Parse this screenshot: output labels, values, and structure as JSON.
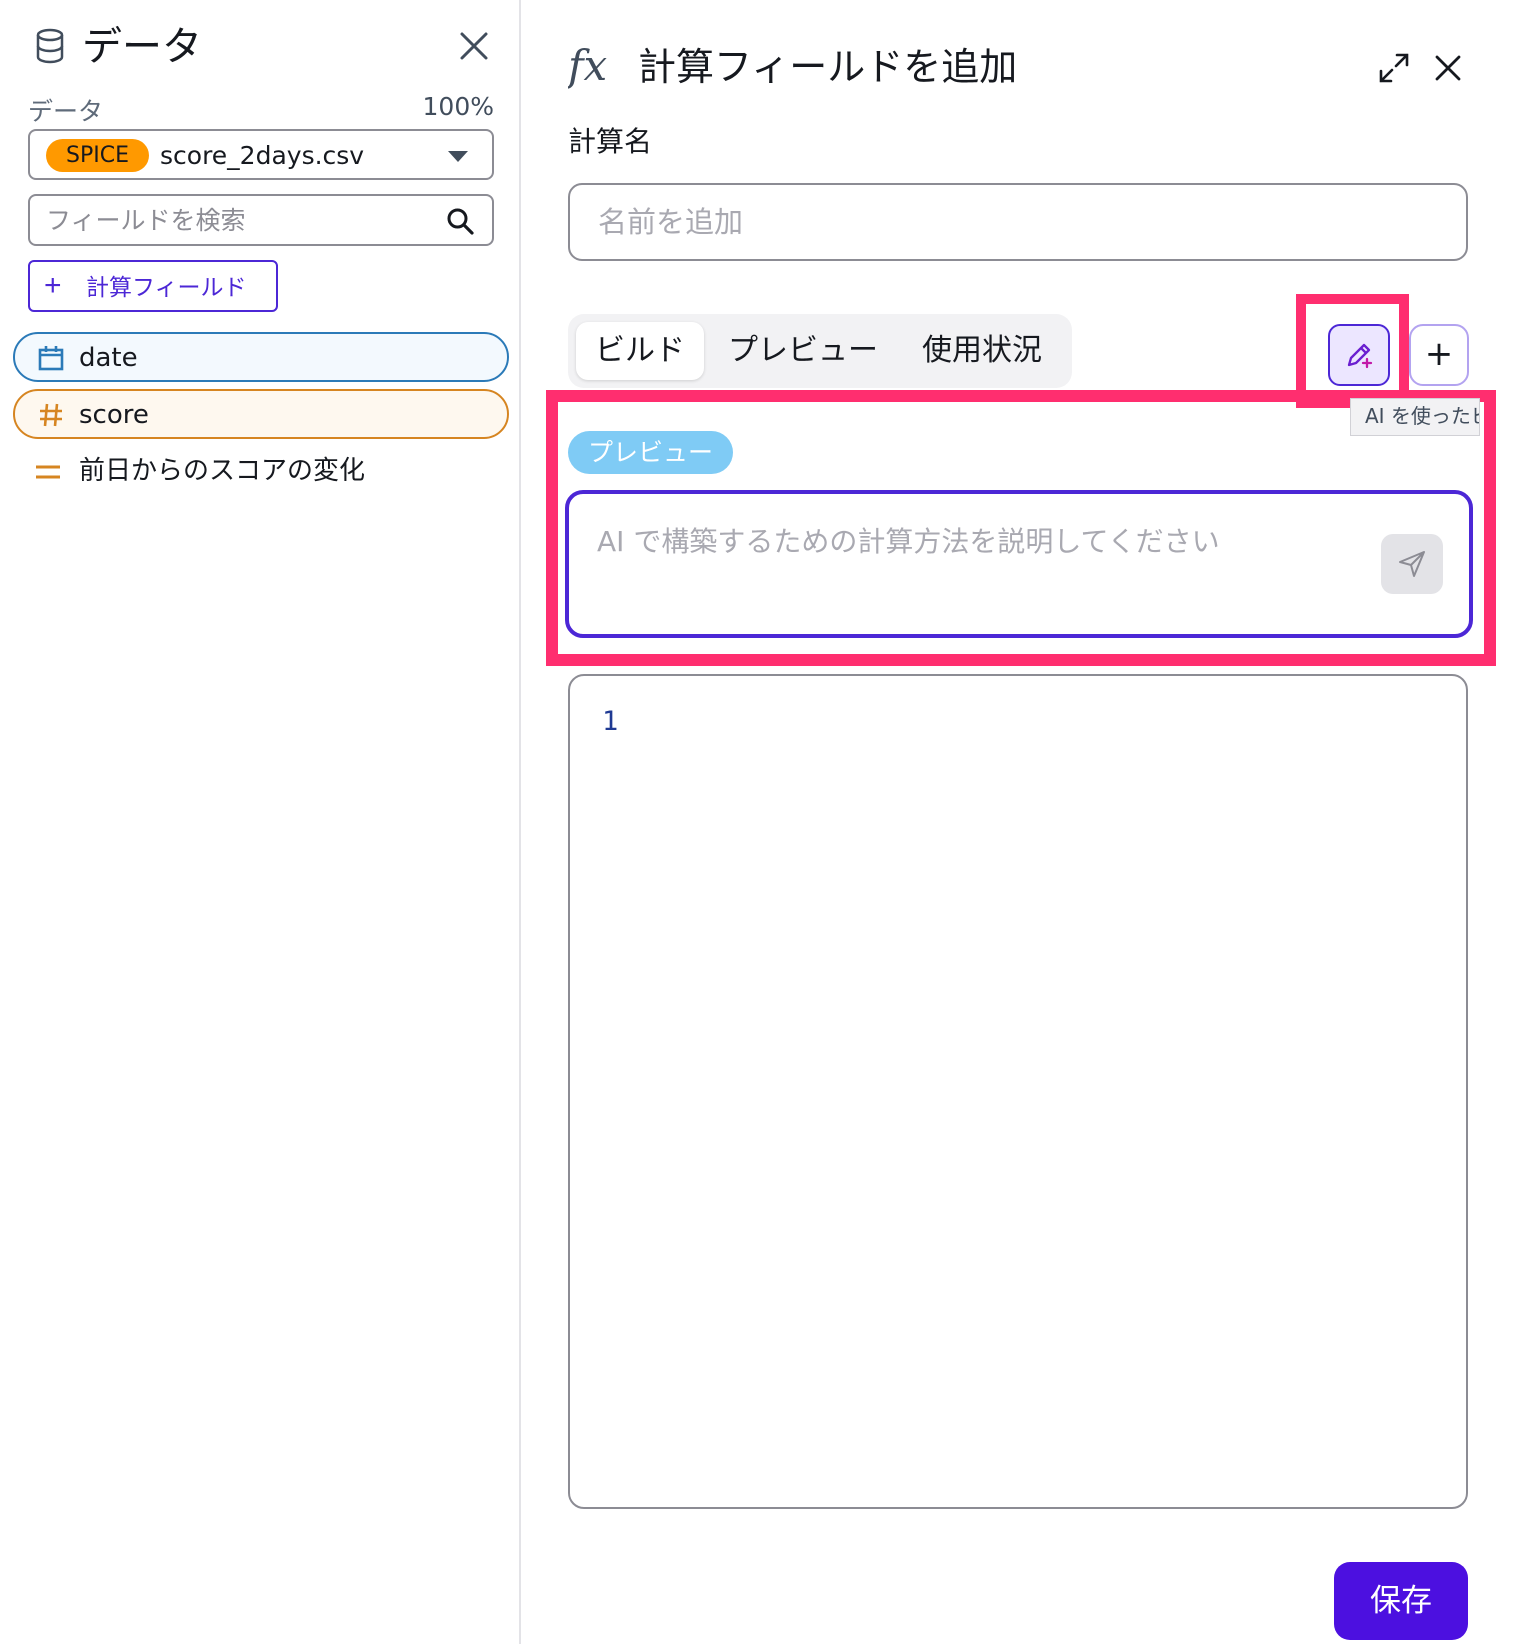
{
  "data_panel": {
    "title": "データ",
    "dataset_label": "データ",
    "dataset_percent": "100%",
    "dataset_badge": "SPICE",
    "dataset_name": "score_2days.csv",
    "search_placeholder": "フィールドを検索",
    "add_calc_button": "計算フィールド",
    "fields": [
      {
        "name": "date",
        "type": "date",
        "icon": "calendar-icon"
      },
      {
        "name": "score",
        "type": "measure",
        "icon": "hash-icon"
      },
      {
        "name": "前日からのスコアの変化",
        "type": "calculated",
        "icon": "equals-icon"
      }
    ]
  },
  "calc_panel": {
    "title": "計算フィールドを追加",
    "name_label": "計算名",
    "name_placeholder": "名前を追加",
    "tabs": [
      {
        "label": "ビルド",
        "active": true
      },
      {
        "label": "プレビュー",
        "active": false
      },
      {
        "label": "使用状況",
        "active": false
      }
    ],
    "plus_label": "+",
    "tooltip": "AI を使ったビ",
    "preview_badge": "プレビュー",
    "ai_placeholder": "AI で構築するための計算方法を説明してください",
    "editor_line": "1",
    "save_label": "保存"
  },
  "colors": {
    "accent": "#4c27d6",
    "highlight": "#ff2e6f",
    "spice": "#ff9900",
    "date_field": "#2b7ab8",
    "measure_field": "#d68521"
  }
}
